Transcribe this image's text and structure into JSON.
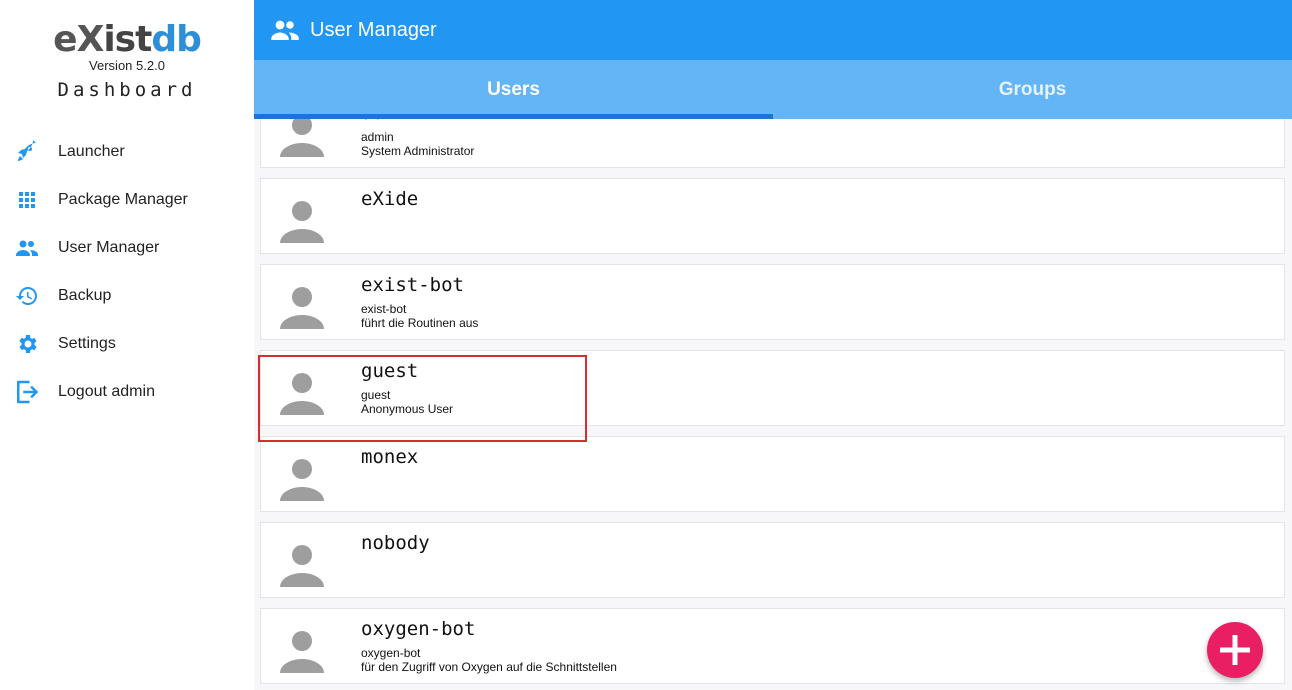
{
  "logo": {
    "brand_e": "e",
    "brand_x": "X",
    "brand_ist": "ist",
    "brand_db": "db",
    "version": "Version 5.2.0",
    "subtitle": "Dashboard"
  },
  "nav": [
    {
      "label": "Launcher",
      "icon": "rocket-icon"
    },
    {
      "label": "Package Manager",
      "icon": "apps-grid-icon"
    },
    {
      "label": "User Manager",
      "icon": "people-icon"
    },
    {
      "label": "Backup",
      "icon": "history-icon"
    },
    {
      "label": "Settings",
      "icon": "gear-icon"
    },
    {
      "label": "Logout admin",
      "icon": "logout-icon"
    }
  ],
  "header": {
    "title": "User Manager",
    "icon": "people-icon"
  },
  "tabs": [
    {
      "label": "Users",
      "active": true
    },
    {
      "label": "Groups",
      "active": false
    }
  ],
  "users": [
    {
      "name": "admin",
      "line1": "admin",
      "line2": "System Administrator"
    },
    {
      "name": "eXide",
      "line1": "",
      "line2": ""
    },
    {
      "name": "exist-bot",
      "line1": "exist-bot",
      "line2": "führt die Routinen aus"
    },
    {
      "name": "guest",
      "line1": "guest",
      "line2": "Anonymous User"
    },
    {
      "name": "monex",
      "line1": "",
      "line2": ""
    },
    {
      "name": "nobody",
      "line1": "",
      "line2": ""
    },
    {
      "name": "oxygen-bot",
      "line1": "oxygen-bot",
      "line2": "für den Zugriff von Oxygen auf die Schnittstellen"
    }
  ],
  "fab": {
    "icon": "plus-icon"
  },
  "colors": {
    "primary": "#2196f3",
    "tabs": "#64b5f6",
    "tab_indicator": "#1976d2",
    "fab": "#e91e63",
    "highlight": "#d32f2f"
  }
}
